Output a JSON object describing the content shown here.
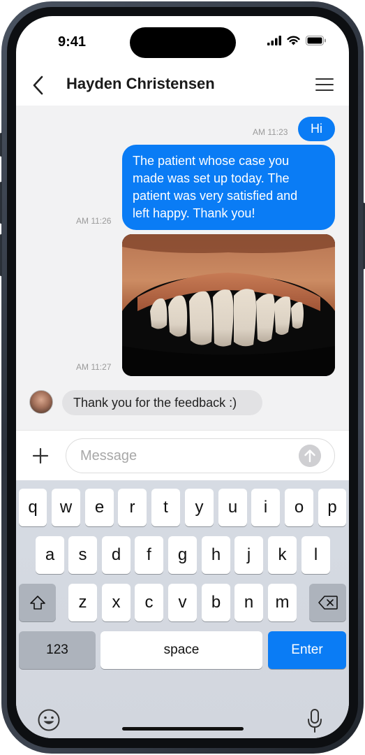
{
  "status_bar": {
    "time": "9:41"
  },
  "header": {
    "contact_name": "Hayden Christensen"
  },
  "messages": [
    {
      "type": "text",
      "direction": "outgoing",
      "text": "Hi",
      "time": "AM 11:23"
    },
    {
      "type": "text",
      "direction": "outgoing",
      "lines": [
        "The patient whose case you",
        "made was set up today. The",
        "patient was very satisfied and",
        "left happy. Thank you!"
      ],
      "time": "AM 11:26"
    },
    {
      "type": "image",
      "direction": "outgoing",
      "subject": "dental-smile-photo",
      "time": "AM 11:27"
    },
    {
      "type": "text",
      "direction": "incoming",
      "text": "Thank you for the feedback :)"
    }
  ],
  "input": {
    "placeholder": "Message",
    "value": ""
  },
  "keyboard": {
    "row1": [
      "q",
      "w",
      "e",
      "r",
      "t",
      "y",
      "u",
      "i",
      "o",
      "p"
    ],
    "row2": [
      "a",
      "s",
      "d",
      "f",
      "g",
      "h",
      "j",
      "k",
      "l"
    ],
    "row3": [
      "z",
      "x",
      "c",
      "v",
      "b",
      "n",
      "m"
    ],
    "numbers_label": "123",
    "space_label": "space",
    "enter_label": "Enter"
  },
  "colors": {
    "accent": "#0a7cf5",
    "chat_bg": "#f2f2f3",
    "incoming_bubble": "#e2e2e4",
    "keyboard_bg": "#d4d8e0"
  },
  "icons": [
    "back-arrow-icon",
    "menu-icon",
    "plus-icon",
    "send-arrow-icon",
    "shift-icon",
    "backspace-icon",
    "emoji-icon",
    "mic-icon",
    "signal-icon",
    "wifi-icon",
    "battery-icon"
  ]
}
